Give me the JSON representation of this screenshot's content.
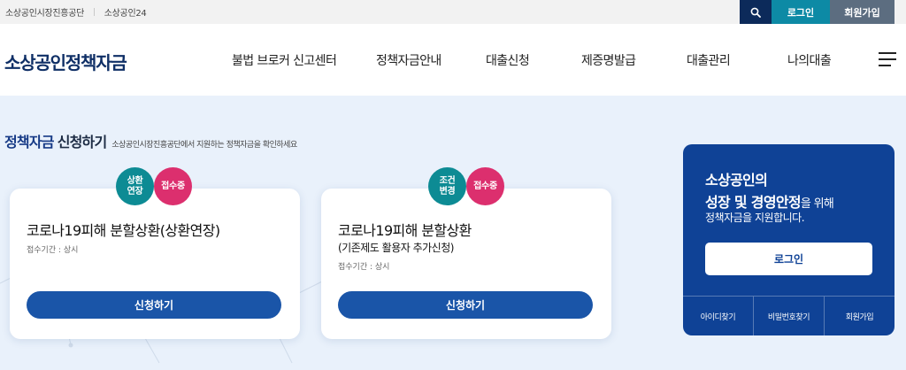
{
  "topbar": {
    "links": [
      "소상공인시장진흥공단",
      "소상공인24"
    ],
    "login_label": "로그인",
    "join_label": "회원가입"
  },
  "header": {
    "logo": "소상공인정책자금",
    "nav": [
      "불법 브로커 신고센터",
      "정책자금안내",
      "대출신청",
      "제증명발급",
      "대출관리",
      "나의대출"
    ]
  },
  "section": {
    "title_accent": "정책자금",
    "title_rest": "신청하기",
    "description": "소상공인시장진흥공단에서 지원하는 정책자금을 확인하세요"
  },
  "cards": [
    {
      "badge_type": "상환\n연장",
      "badge_status": "접수중",
      "title": "코로나19피해 분할상환(상환연장)",
      "subtitle": "",
      "period": "접수기간 : 상시",
      "button": "신청하기"
    },
    {
      "badge_type": "조건\n변경",
      "badge_status": "접수중",
      "title": "코로나19피해 분할상환",
      "subtitle": "(기존제도 활용자 추가신청)",
      "period": "접수기간 : 상시",
      "button": "신청하기"
    }
  ],
  "panel": {
    "line1": "소상공인의",
    "line2_strong": "성장 및 경영안정",
    "line2_rest": "을 위해",
    "line3": "정책자금을 지원합니다.",
    "login_button": "로그인",
    "links": [
      "아이디찾기",
      "비밀번호찾기",
      "회원가입"
    ]
  },
  "colors": {
    "navy": "#0c2a5a",
    "teal": "#0d8aa5",
    "slate": "#5c6d80",
    "brand_blue": "#0f4296",
    "button_blue": "#1a55a8",
    "badge_teal": "#0d8b94",
    "badge_pink": "#dc2f6e",
    "page_bg": "#e9f1fb"
  },
  "icons": {
    "search": "search-icon",
    "menu": "hamburger-menu-icon"
  }
}
